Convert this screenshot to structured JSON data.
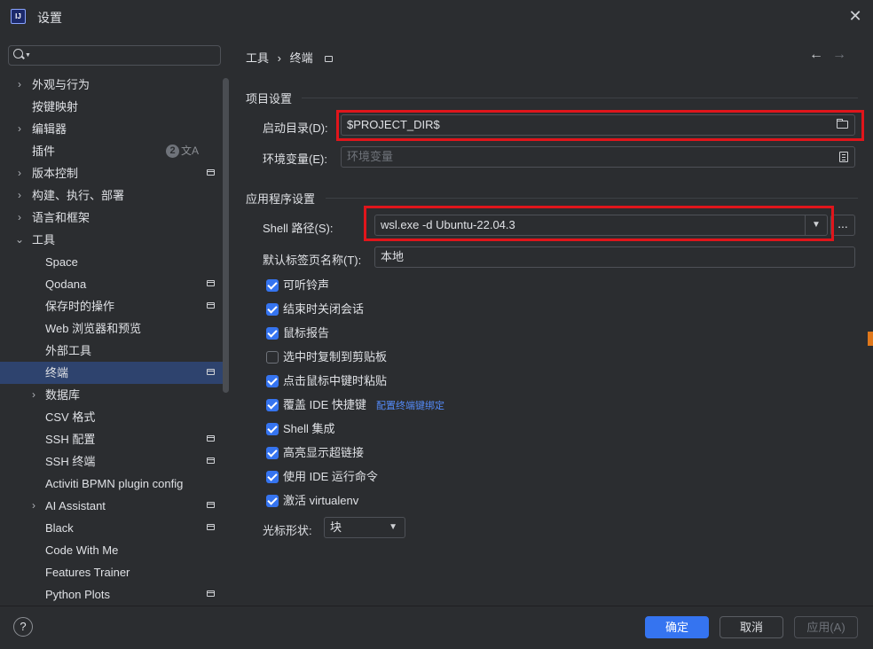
{
  "window": {
    "title": "设置",
    "logo_text": "IJ"
  },
  "search": {
    "placeholder": ""
  },
  "sidebar": {
    "items": [
      {
        "label": "外观与行为",
        "expanded": false,
        "has_children": true,
        "indent": 0,
        "bold": true
      },
      {
        "label": "按键映射",
        "has_children": false,
        "indent": 0,
        "bold": true
      },
      {
        "label": "编辑器",
        "expanded": false,
        "has_children": true,
        "indent": 0,
        "bold": true
      },
      {
        "label": "插件",
        "has_children": false,
        "indent": 0,
        "bold": true,
        "badge": "2",
        "translate_icon": "文A"
      },
      {
        "label": "版本控制",
        "expanded": false,
        "has_children": true,
        "indent": 0,
        "bold": true,
        "project_icon": true
      },
      {
        "label": "构建、执行、部署",
        "expanded": false,
        "has_children": true,
        "indent": 0,
        "bold": true
      },
      {
        "label": "语言和框架",
        "expanded": false,
        "has_children": true,
        "indent": 0,
        "bold": true
      },
      {
        "label": "工具",
        "expanded": true,
        "has_children": true,
        "indent": 0,
        "bold": true
      },
      {
        "label": "Space",
        "indent": 1
      },
      {
        "label": "Qodana",
        "indent": 1,
        "project_icon": true
      },
      {
        "label": "保存时的操作",
        "indent": 1,
        "project_icon": true
      },
      {
        "label": "Web 浏览器和预览",
        "indent": 1
      },
      {
        "label": "外部工具",
        "indent": 1
      },
      {
        "label": "终端",
        "indent": 1,
        "project_icon": true,
        "selected": true
      },
      {
        "label": "数据库",
        "indent": 1,
        "has_children": true,
        "expanded": false
      },
      {
        "label": "CSV 格式",
        "indent": 1
      },
      {
        "label": "SSH 配置",
        "indent": 1,
        "project_icon": true
      },
      {
        "label": "SSH 终端",
        "indent": 1,
        "project_icon": true
      },
      {
        "label": "Activiti BPMN plugin config",
        "indent": 1
      },
      {
        "label": "AI Assistant",
        "indent": 1,
        "has_children": true,
        "expanded": false,
        "project_icon": true
      },
      {
        "label": "Black",
        "indent": 1,
        "project_icon": true
      },
      {
        "label": "Code With Me",
        "indent": 1
      },
      {
        "label": "Features Trainer",
        "indent": 1
      },
      {
        "label": "Python Plots",
        "indent": 1,
        "project_icon": true
      }
    ]
  },
  "breadcrumb": {
    "parent": "工具",
    "separator": "›",
    "current": "终端"
  },
  "project_section": {
    "title": "项目设置",
    "start_dir_label": "启动目录(D):",
    "start_dir_value": "$PROJECT_DIR$",
    "env_label": "环境变量(E):",
    "env_placeholder": "环境变量"
  },
  "app_section": {
    "title": "应用程序设置",
    "shell_label": "Shell 路径(S):",
    "shell_value": "wsl.exe -d Ubuntu-22.04.3",
    "ellipsis": "...",
    "tab_name_label": "默认标签页名称(T):",
    "tab_name_value": "本地",
    "checkboxes": [
      {
        "label": "可听铃声",
        "checked": true
      },
      {
        "label": "结束时关闭会话",
        "checked": true
      },
      {
        "label": "鼠标报告",
        "checked": true
      },
      {
        "label": "选中时复制到剪贴板",
        "checked": false
      },
      {
        "label": "点击鼠标中键时粘贴",
        "checked": true
      },
      {
        "label": "覆盖 IDE 快捷键",
        "checked": true,
        "link": "配置终端键绑定"
      },
      {
        "label": "Shell 集成",
        "checked": true
      },
      {
        "label": "高亮显示超链接",
        "checked": true
      },
      {
        "label": "使用 IDE 运行命令",
        "checked": true
      },
      {
        "label": "激活 virtualenv",
        "checked": true
      }
    ],
    "cursor_label": "光标形状:",
    "cursor_value": "块"
  },
  "footer": {
    "help": "?",
    "ok": "确定",
    "cancel": "取消",
    "apply": "应用(A)"
  },
  "colors": {
    "background": "#2b2d30",
    "accent": "#3574f0",
    "selection": "#2e436e",
    "highlight_box": "#e0151b",
    "link": "#548af7"
  }
}
